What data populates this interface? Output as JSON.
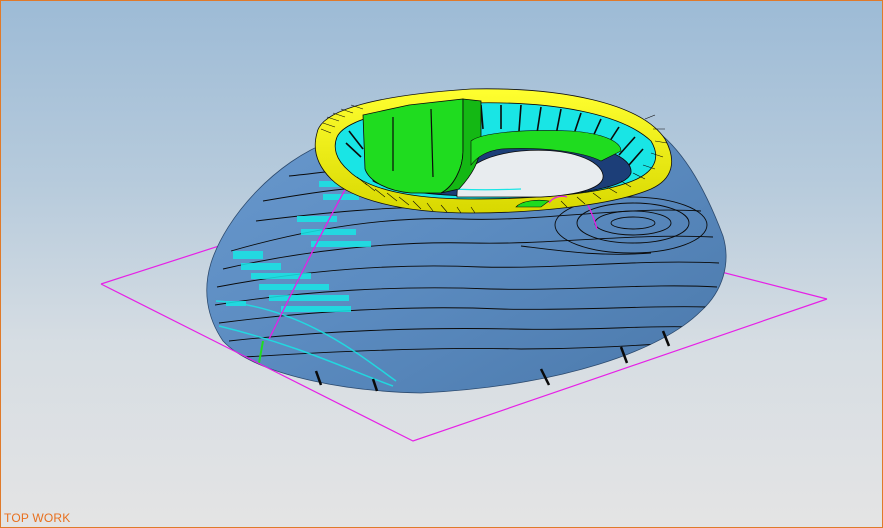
{
  "viewport": {
    "view_name": "TOP WORK",
    "colors": {
      "border": "#e07a2a",
      "label": "#e8701e",
      "background_top": "#9dbbd6",
      "background_bottom": "#e4e4e4",
      "part_surface": "#5f8fc4",
      "toolpath_contours": "#0a0a0a",
      "toolpath_highlight": "#19e5e5",
      "rim_face": "#f2f20a",
      "pocket_wall": "#1fdc1f",
      "work_plane": "#e620e6"
    }
  },
  "model": {
    "shape": "domed-part-with-pocket",
    "work_plane_icon": "work-plane-outline"
  }
}
